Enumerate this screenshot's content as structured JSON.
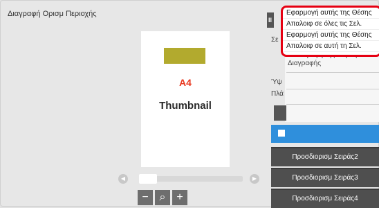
{
  "window": {
    "title": "Διαγραφή Ορισμ Περιοχής"
  },
  "preview": {
    "paper_size": "A4",
    "label": "Thumbnail",
    "zoom_out": "−",
    "zoom": "⌕",
    "zoom_in": "+",
    "scroll_left": "◀",
    "scroll_right": "▶"
  },
  "panel": {
    "fragment_i": "II",
    "fragment_sigma": "Σε",
    "fragment_upsilon": "Ύψ",
    "fragment_pla": "Πλά",
    "reverse_label": "Αντιστροφή της Σειράς Διαγραφής",
    "sequence_buttons": [
      "Προσδιορισμ Σειράς2",
      "Προσδιορισμ Σειράς3",
      "Προσδιορισμ Σειράς4"
    ]
  },
  "menu": {
    "items": [
      "Εφαρμογή αυτής της Θέσης",
      "Απαλοιφ σε όλες τις Σελ.",
      "Εφαρμογή αυτής της Θέσης",
      "Απαλοιφ σε αυτή τη Σελ."
    ]
  },
  "colors": {
    "accent_blue": "#2f8fdc",
    "highlight_red": "#e60012",
    "thumb_title": "#e8371e"
  }
}
